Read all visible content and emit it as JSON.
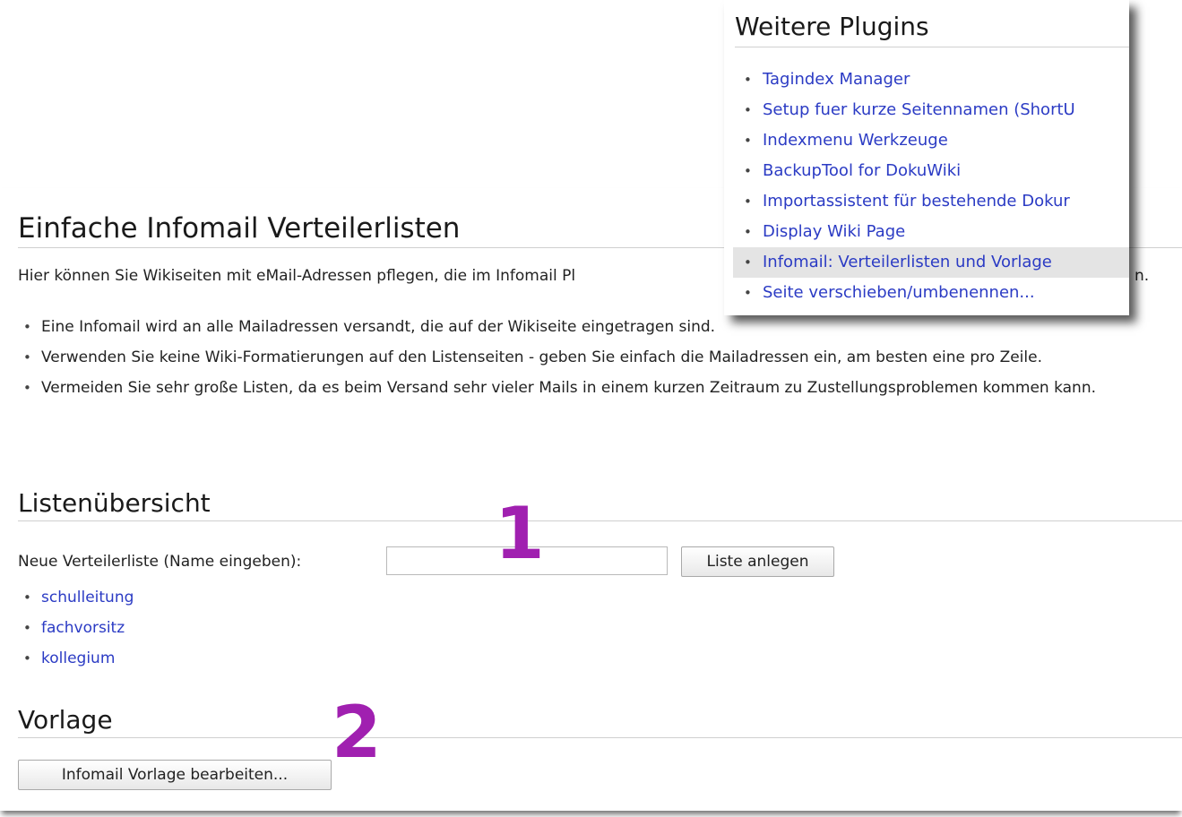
{
  "plugins_menu": {
    "title": "Weitere Plugins",
    "items": [
      {
        "label": "Tagindex Manager"
      },
      {
        "label": "Setup fuer kurze Seitennamen (ShortU"
      },
      {
        "label": "Indexmenu Werkzeuge"
      },
      {
        "label": "BackupTool for DokuWiki"
      },
      {
        "label": "Importassistent für bestehende Dokur"
      },
      {
        "label": "Display Wiki Page"
      },
      {
        "label": "Infomail: Verteilerlisten und Vorlage",
        "active": true
      },
      {
        "label": "Seite verschieben/umbenennen..."
      }
    ]
  },
  "main": {
    "title": "Einfache Infomail Verteilerlisten",
    "intro": "Hier können Sie Wikiseiten mit eMail-Adressen pflegen, die im Infomail Pl",
    "intro_end": "n.",
    "rules": [
      "Eine Infomail wird an alle Mailadressen versandt, die auf der Wikiseite eingetragen sind.",
      "Verwenden Sie keine Wiki-Formatierungen auf den Listenseiten - geben Sie einfach die Mailadressen ein, am besten eine pro Zeile.",
      "Vermeiden Sie sehr große Listen, da es beim Versand sehr vieler Mails in einem kurzen Zeitraum zu Zustellungsproblemen kommen kann."
    ]
  },
  "lists_section": {
    "title": "Listenübersicht",
    "new_label": "Neue Verteilerliste (Name eingeben):",
    "new_value": "",
    "create_button": "Liste anlegen",
    "lists": [
      "schulleitung",
      "fachvorsitz",
      "kollegium"
    ]
  },
  "template_section": {
    "title": "Vorlage",
    "edit_button": "Infomail Vorlage bearbeiten..."
  },
  "annotations": {
    "marker_1": "1",
    "marker_2": "2",
    "color": "#a020b0"
  }
}
